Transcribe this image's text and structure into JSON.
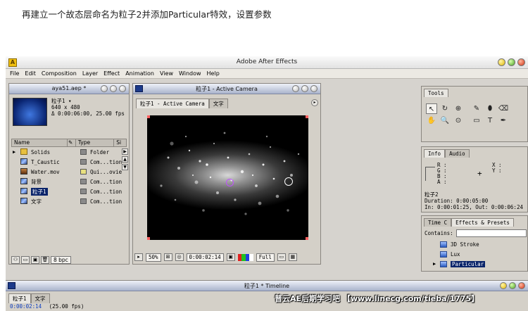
{
  "caption": "再建立一个故态层命名为粒子2并添加Particular特效，设置参数",
  "app": {
    "title": "Adobe After Effects",
    "menu": [
      "File",
      "Edit",
      "Composition",
      "Layer",
      "Effect",
      "Animation",
      "View",
      "Window",
      "Help"
    ]
  },
  "project": {
    "title": "aya51.aep *",
    "info_line1": "粒子1 ▾",
    "info_line2": "640 x 480",
    "info_line3": "Δ 0:00:06:00, 25.00 fps",
    "columns": [
      "Name",
      "Type",
      "Si"
    ],
    "items": [
      {
        "name": "Solids",
        "type": "Folder",
        "icon": "folder-icon",
        "label_color": "#8a8a8a",
        "expander": "▶"
      },
      {
        "name": "T_Caustic",
        "type": "Com...tion",
        "icon": "composition-icon",
        "label_color": "#8a8a8a"
      },
      {
        "name": "Water.mov",
        "type": "Qui...ovie",
        "icon": "movie-icon",
        "label_color": "#e8e080"
      },
      {
        "name": "背景",
        "type": "Com...tion",
        "icon": "composition-icon",
        "label_color": "#8a8a8a"
      },
      {
        "name": "粒子1",
        "type": "Com...tion",
        "icon": "composition-icon",
        "label_color": "#8a8a8a",
        "selected": true
      },
      {
        "name": "文字",
        "type": "Com...tion",
        "icon": "composition-icon",
        "label_color": "#8a8a8a"
      }
    ],
    "bpc": "8 bpc"
  },
  "composition": {
    "title": "粒子1 - Active Camera",
    "tabs": [
      "粒子1 - Active Camera",
      "文字"
    ],
    "zoom": "50%",
    "timecode": "0:00:02:14",
    "resolution": "Full"
  },
  "tools": {
    "title": "Tools",
    "items_left": [
      "↖",
      "↻",
      "⊕",
      "✋",
      "🔍",
      "⊙"
    ],
    "items_right": [
      "✎",
      "⬮",
      "⌫",
      "",
      "▭",
      "T",
      "✒",
      ""
    ]
  },
  "info": {
    "tabs": [
      "Info",
      "Audio"
    ],
    "r": "R :",
    "g": "G :",
    "b": "B :",
    "a": "A :",
    "x": "X :",
    "y": "Y :",
    "layer": "粒子2",
    "duration": "Duration: 0:00:05:00",
    "inout": "In: 0:00:01:25, Out: 0:00:06:24"
  },
  "effects": {
    "tabs": [
      "Time C",
      "Effects & Presets"
    ],
    "contains_label": "Contains:",
    "items": [
      "3D Stroke",
      "Lux",
      "Particular"
    ],
    "selected": "Particular"
  },
  "timeline": {
    "title": "粒子1 * Timeline",
    "tabs": [
      "粒子1",
      "文字"
    ],
    "timecode": "0:00:02:14",
    "fps": "(25.00 fps)"
  },
  "watermark": "普云AE后期学习吧 【www.linecg.com/tieba/1775】"
}
